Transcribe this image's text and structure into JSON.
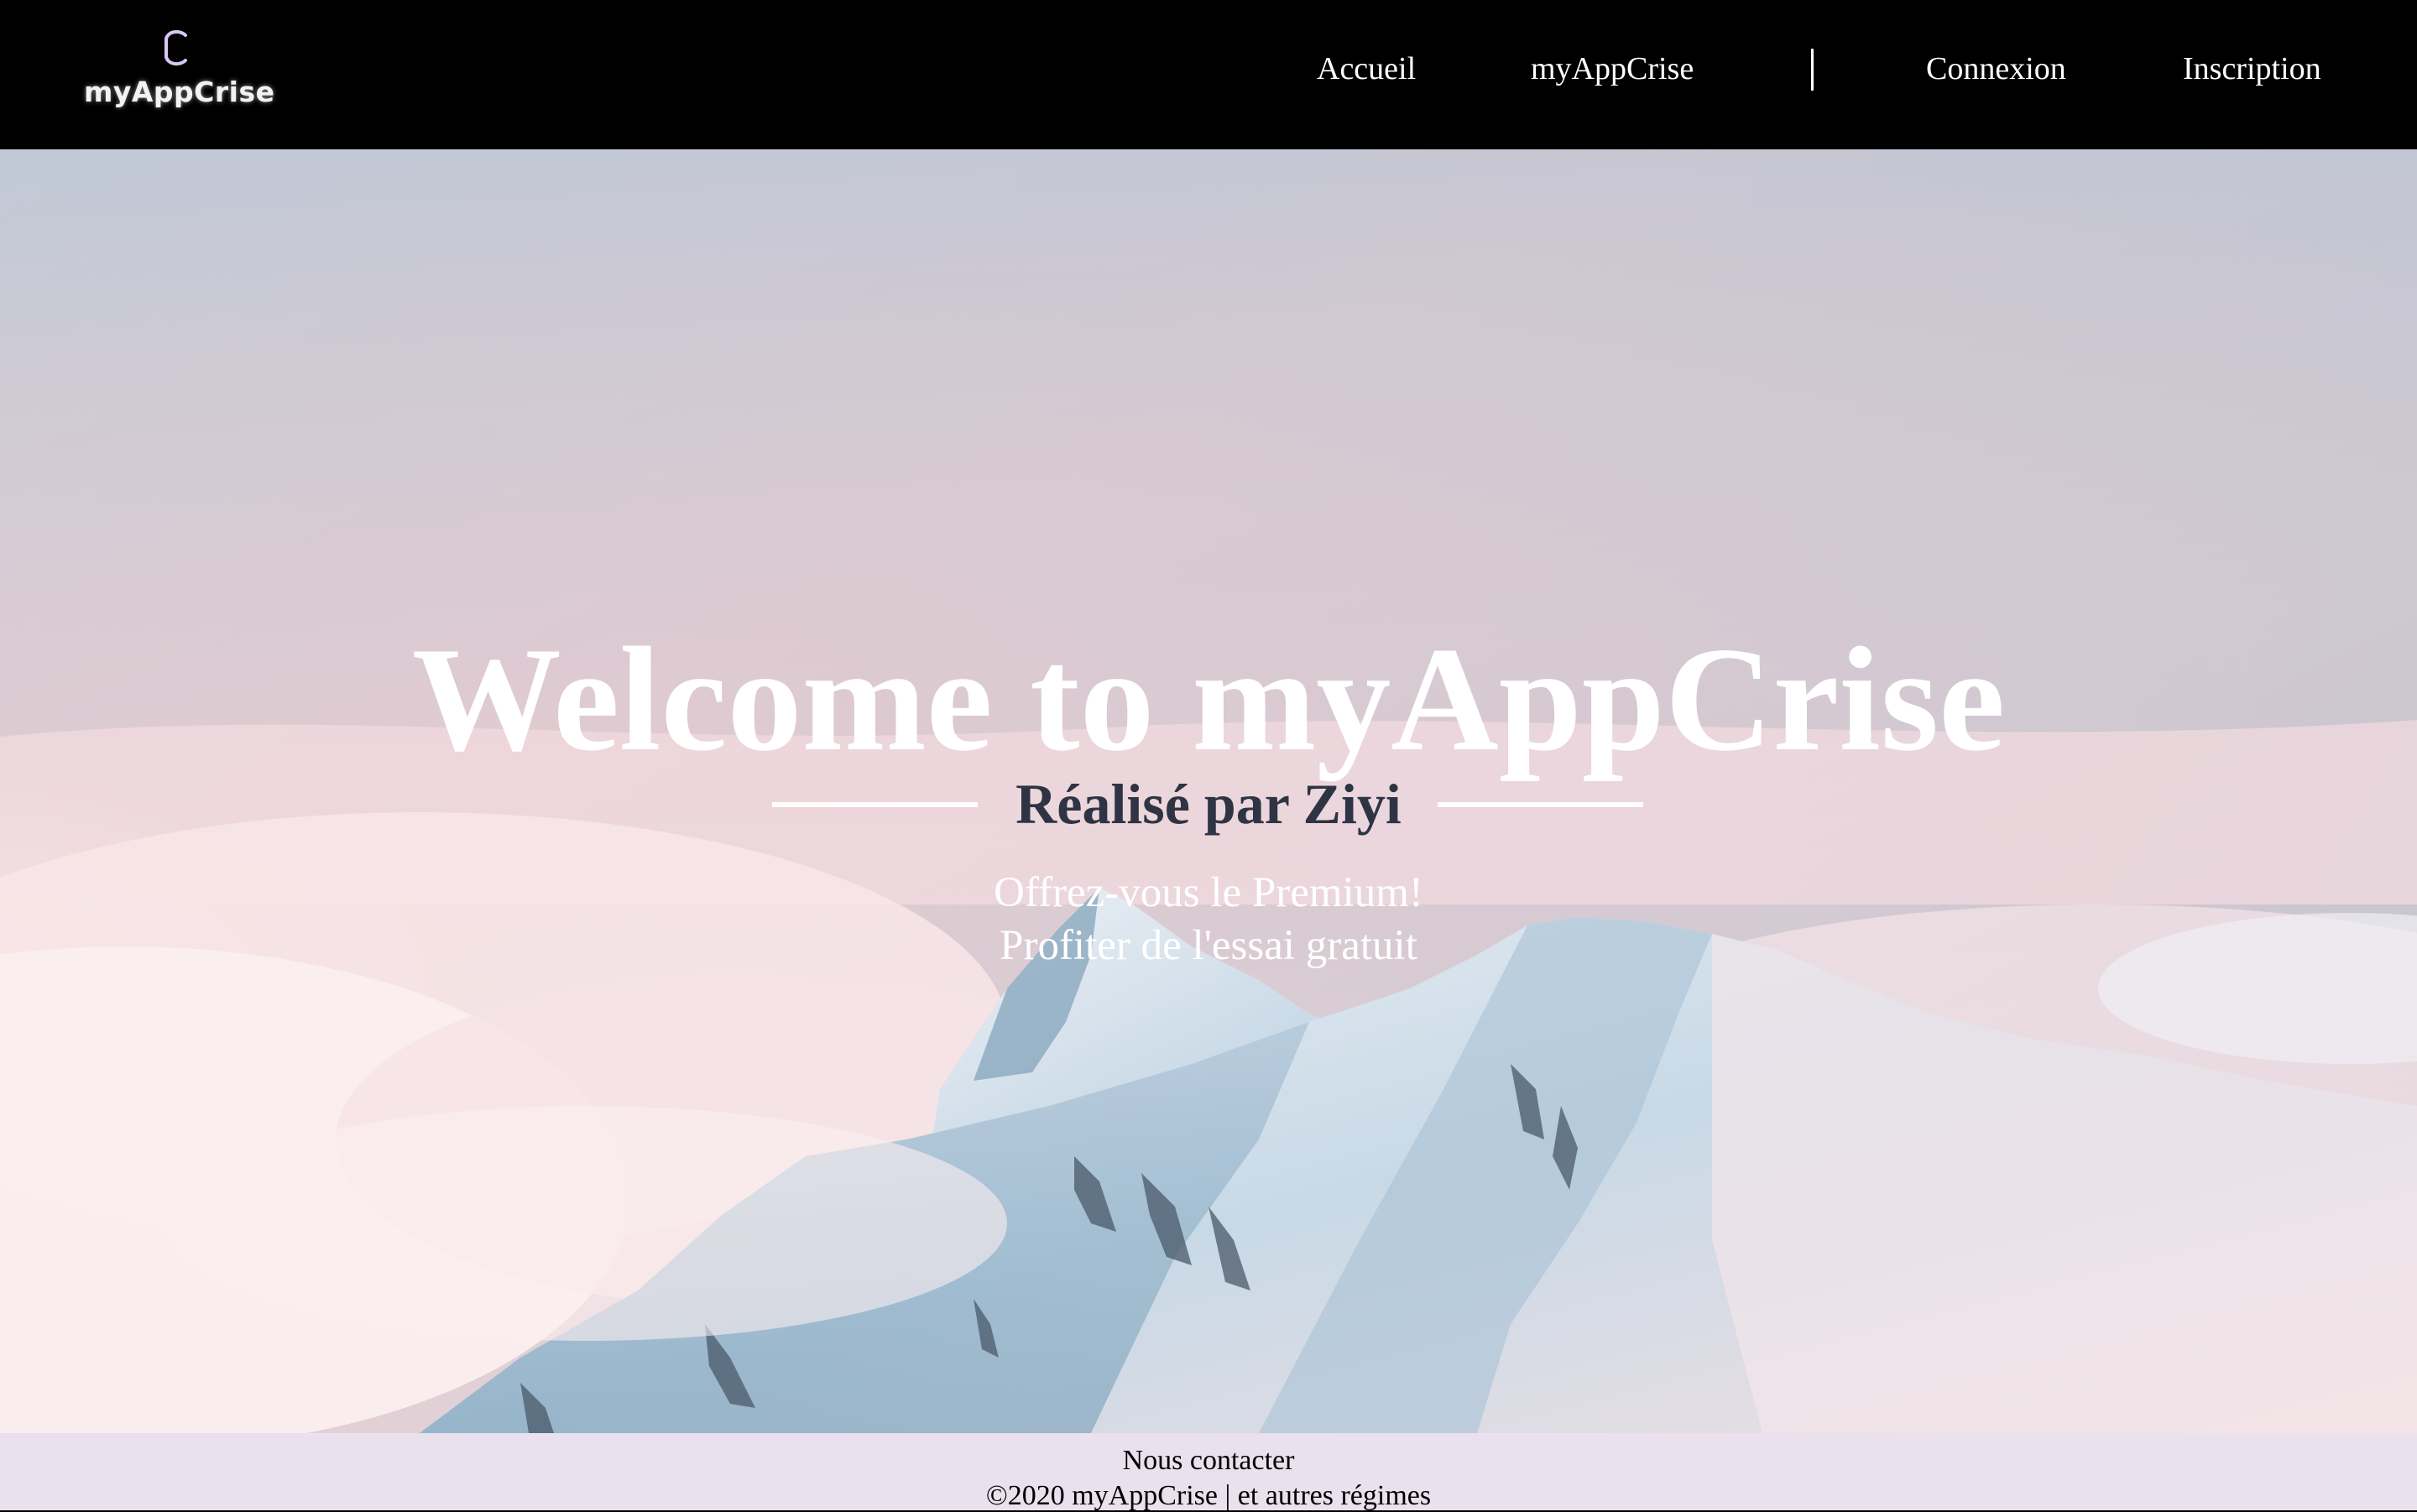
{
  "brand": {
    "name": "myAppCrise",
    "logo_icon": "c-logo-icon"
  },
  "nav": {
    "links": [
      {
        "label": "Accueil"
      },
      {
        "label": "myAppCrise"
      },
      {
        "label": "Connexion"
      },
      {
        "label": "Inscription"
      }
    ]
  },
  "hero": {
    "title": "Welcome to myAppCrise",
    "subtitle": "Réalisé par Ziyi",
    "promo_line1": "Offrez-vous le Premium!",
    "promo_line2": "Profiter de l'essai gratuit"
  },
  "footer": {
    "contact": "Nous contacter",
    "copyright": "©2020 myAppCrise | et autres régimes"
  },
  "colors": {
    "navbar_bg": "#000000",
    "footer_bg": "#ebe0ed",
    "subtitle_text": "#2e3444",
    "logo_accent": "#c9b6ea"
  }
}
